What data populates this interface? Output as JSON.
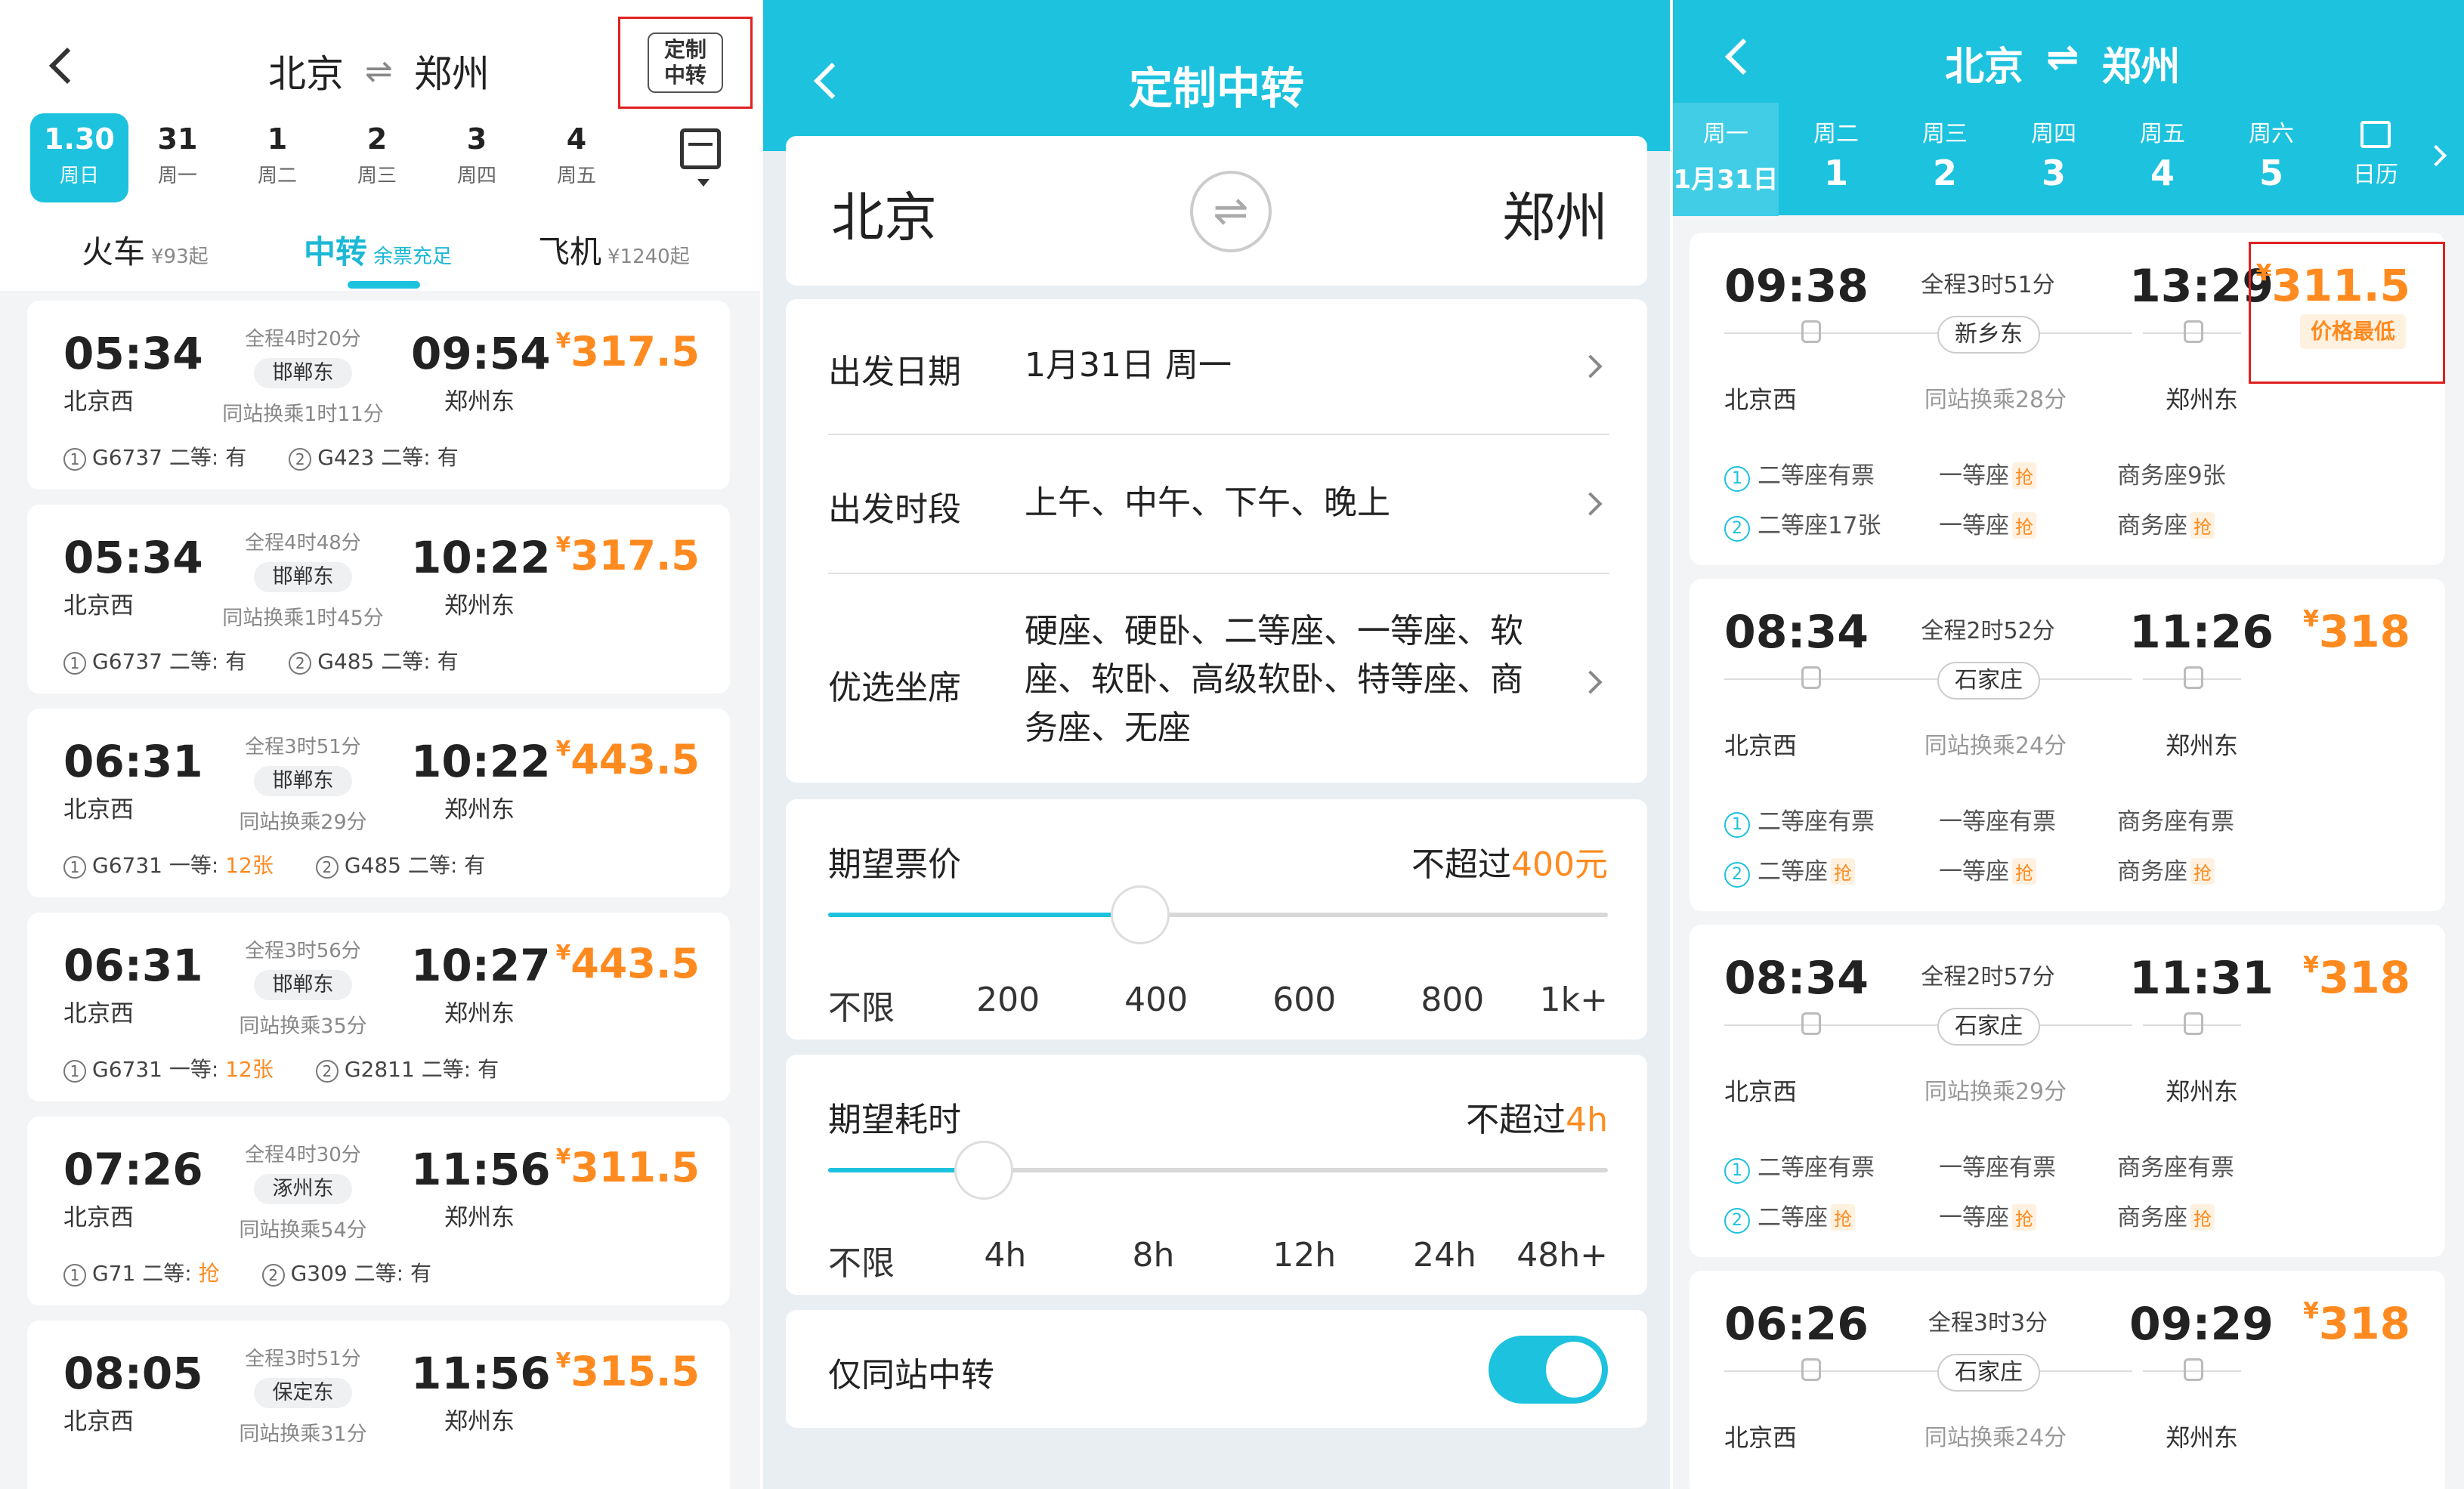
{
  "panel1": {
    "route": {
      "from": "北京",
      "to": "郑州",
      "swap_glyph": "⇌"
    },
    "custom_btn": "定制中转",
    "dates": [
      {
        "num": "1.30",
        "week": "周日",
        "active": true
      },
      {
        "num": "31",
        "week": "周一"
      },
      {
        "num": "1",
        "week": "周二"
      },
      {
        "num": "2",
        "week": "周三"
      },
      {
        "num": "3",
        "week": "周四"
      },
      {
        "num": "4",
        "week": "周五"
      }
    ],
    "modes": [
      {
        "name": "火车",
        "sub": "¥93起"
      },
      {
        "name": "中转",
        "sub": "余票充足",
        "active": true
      },
      {
        "name": "飞机",
        "sub": "¥1240起"
      }
    ],
    "trips": [
      {
        "dep": "05:34",
        "arr": "09:54",
        "dur": "全程4时20分",
        "via": "邯郸东",
        "trans": "同站换乘1时11分",
        "price": "317.5",
        "from": "北京西",
        "to": "郑州东",
        "leg1": {
          "train": "G6737",
          "seat": "二等:",
          "avail": "有"
        },
        "leg2": {
          "train": "G423",
          "seat": "二等:",
          "avail": "有"
        }
      },
      {
        "dep": "05:34",
        "arr": "10:22",
        "dur": "全程4时48分",
        "via": "邯郸东",
        "trans": "同站换乘1时45分",
        "price": "317.5",
        "from": "北京西",
        "to": "郑州东",
        "leg1": {
          "train": "G6737",
          "seat": "二等:",
          "avail": "有"
        },
        "leg2": {
          "train": "G485",
          "seat": "二等:",
          "avail": "有"
        }
      },
      {
        "dep": "06:31",
        "arr": "10:22",
        "dur": "全程3时51分",
        "via": "邯郸东",
        "trans": "同站换乘29分",
        "price": "443.5",
        "from": "北京西",
        "to": "郑州东",
        "leg1": {
          "train": "G6731",
          "seat": "一等:",
          "avail": "12张"
        },
        "leg2": {
          "train": "G485",
          "seat": "二等:",
          "avail": "有"
        }
      },
      {
        "dep": "06:31",
        "arr": "10:27",
        "dur": "全程3时56分",
        "via": "邯郸东",
        "trans": "同站换乘35分",
        "price": "443.5",
        "from": "北京西",
        "to": "郑州东",
        "leg1": {
          "train": "G6731",
          "seat": "一等:",
          "avail": "12张"
        },
        "leg2": {
          "train": "G2811",
          "seat": "二等:",
          "avail": "有"
        }
      },
      {
        "dep": "07:26",
        "arr": "11:56",
        "dur": "全程4时30分",
        "via": "涿州东",
        "trans": "同站换乘54分",
        "price": "311.5",
        "from": "北京西",
        "to": "郑州东",
        "leg1": {
          "train": "G71",
          "seat": "二等:",
          "avail": "抢"
        },
        "leg2": {
          "train": "G309",
          "seat": "二等:",
          "avail": "有"
        }
      },
      {
        "dep": "08:05",
        "arr": "11:56",
        "dur": "全程3时51分",
        "via": "保定东",
        "trans": "同站换乘31分",
        "price": "315.5",
        "from": "北京西",
        "to": "郑州东"
      }
    ]
  },
  "panel2": {
    "title": "定制中转",
    "from": "北京",
    "to": "郑州",
    "swap_glyph": "⇌",
    "options": [
      {
        "label": "出发日期",
        "value": "1月31日 周一"
      },
      {
        "label": "出发时段",
        "value": "上午、中午、下午、晚上"
      },
      {
        "label": "优选坐席",
        "value": "硬座、硬卧、二等座、一等座、软座、软卧、高级软卧、特等座、商务座、无座"
      }
    ],
    "price_slider": {
      "label": "期望票价",
      "value_prefix": "不超过",
      "value": "400元",
      "level": 0.4,
      "ticks": [
        "不限",
        "200",
        "400",
        "600",
        "800",
        "1k+"
      ]
    },
    "time_slider": {
      "label": "期望耗时",
      "value_prefix": "不超过",
      "value": "4h",
      "level": 0.2,
      "ticks": [
        "不限",
        "4h",
        "8h",
        "12h",
        "24h",
        "48h+"
      ]
    },
    "same_station": {
      "label": "仅同站中转",
      "on": true
    }
  },
  "panel3": {
    "route": {
      "from": "北京",
      "to": "郑州",
      "swap_glyph": "⇌"
    },
    "dates": [
      {
        "week": "周一",
        "num": "1月31日",
        "active": true
      },
      {
        "week": "周二",
        "num": "1"
      },
      {
        "week": "周三",
        "num": "2"
      },
      {
        "week": "周四",
        "num": "3"
      },
      {
        "week": "周五",
        "num": "4"
      },
      {
        "week": "周六",
        "num": "5"
      }
    ],
    "calendar_label": "日历",
    "lowest_badge": "价格最低",
    "trips": [
      {
        "dep": "09:38",
        "arr": "13:29",
        "dur": "全程3时51分",
        "via": "新乡东",
        "trans": "同站换乘28分",
        "price": "311.5",
        "from": "北京西",
        "to": "郑州东",
        "leg1": [
          "二等座有票",
          "一等座",
          "商务座9张"
        ],
        "leg2": [
          "二等座17张",
          "一等座",
          "商务座"
        ]
      },
      {
        "dep": "08:34",
        "arr": "11:26",
        "dur": "全程2时52分",
        "via": "石家庄",
        "trans": "同站换乘24分",
        "price": "318",
        "from": "北京西",
        "to": "郑州东",
        "leg1": [
          "二等座有票",
          "一等座有票",
          "商务座有票"
        ],
        "leg2": [
          "二等座",
          "一等座",
          "商务座"
        ]
      },
      {
        "dep": "08:34",
        "arr": "11:31",
        "dur": "全程2时57分",
        "via": "石家庄",
        "trans": "同站换乘29分",
        "price": "318",
        "from": "北京西",
        "to": "郑州东",
        "leg1": [
          "二等座有票",
          "一等座有票",
          "商务座有票"
        ],
        "leg2": [
          "二等座",
          "一等座",
          "商务座"
        ]
      },
      {
        "dep": "06:26",
        "arr": "09:29",
        "dur": "全程3时3分",
        "via": "石家庄",
        "trans": "同站换乘24分",
        "price": "318",
        "from": "北京西",
        "to": "郑州东"
      }
    ],
    "qiang": "抢"
  },
  "colors": {
    "accent": "#1cc2de",
    "price": "#ff8a1f",
    "highlight_box": "#e02020"
  },
  "icons": [
    "back-arrow-icon",
    "swap-icon",
    "calendar-icon",
    "chevron-right-icon",
    "train-icon"
  ]
}
